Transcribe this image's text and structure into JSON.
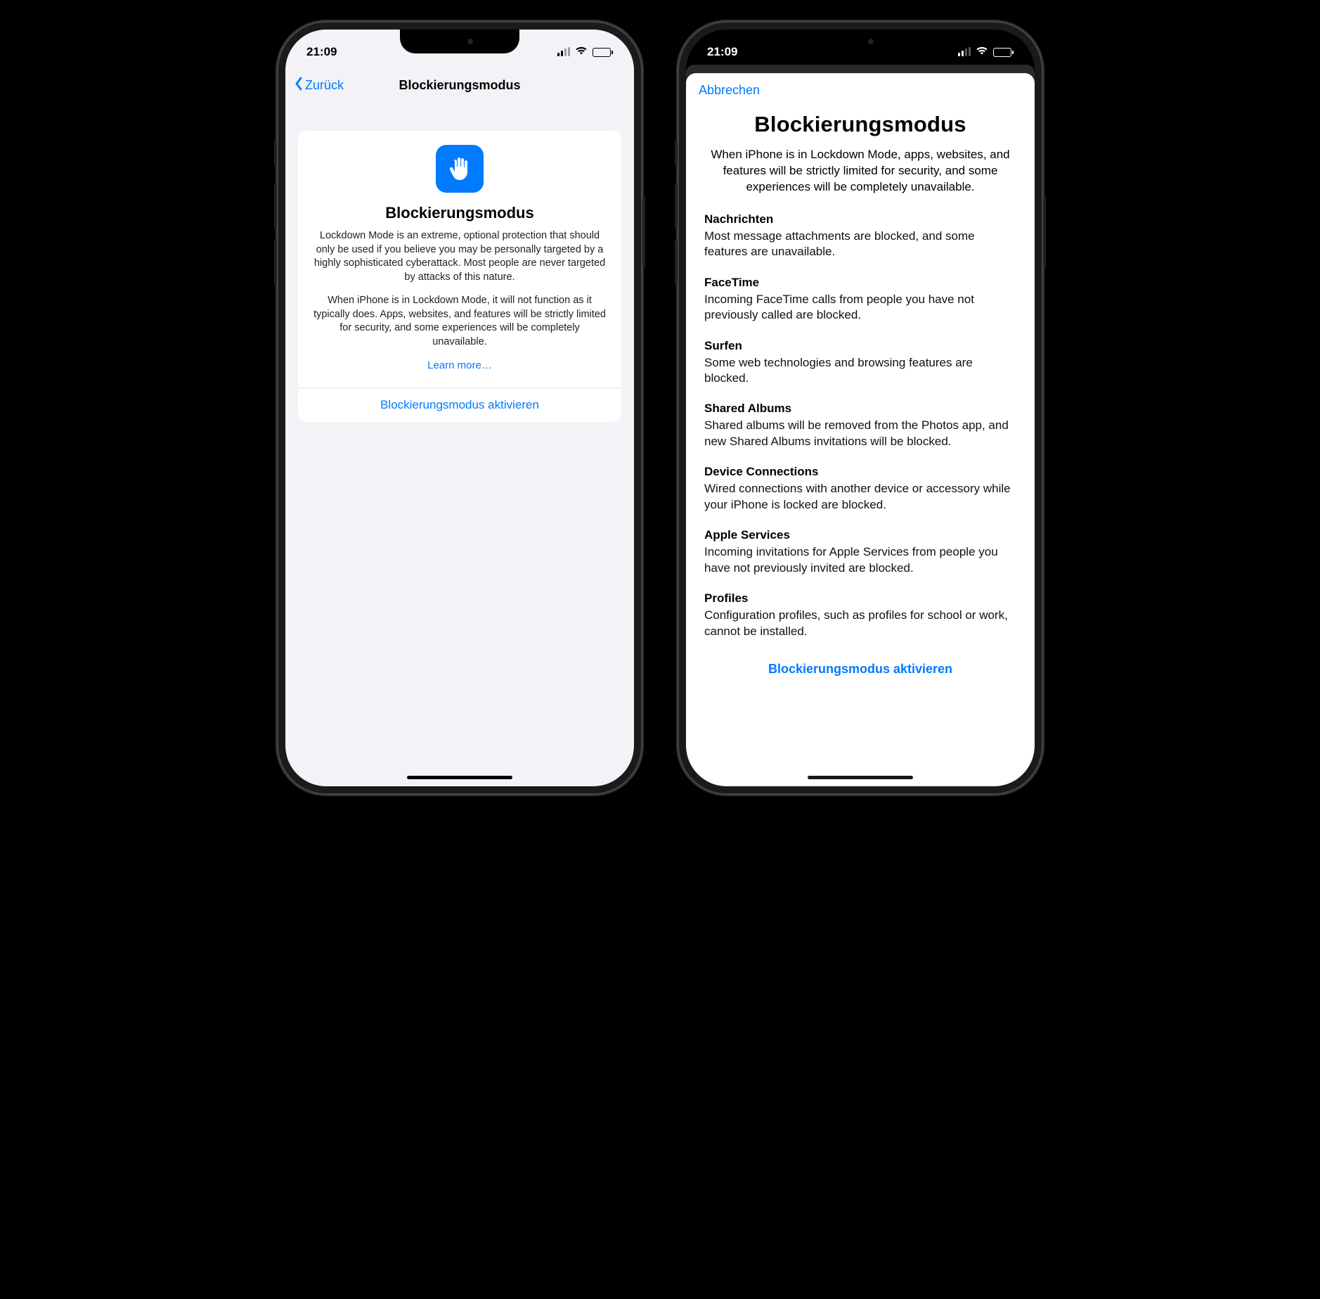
{
  "status": {
    "time": "21:09"
  },
  "left": {
    "back_label": "Zurück",
    "nav_title": "Blockierungsmodus",
    "icon_name": "hand-raised-icon",
    "card_title": "Blockierungsmodus",
    "paragraph1": "Lockdown Mode is an extreme, optional protection that should only be used if you believe you may be personally targeted by a highly sophisticated cyberattack. Most people are never targeted by attacks of this nature.",
    "paragraph2": "When iPhone is in Lockdown Mode, it will not function as it typically does. Apps, websites, and features will be strictly limited for security, and some experiences will be completely unavailable.",
    "learn_more": "Learn more…",
    "activate": "Blockierungsmodus aktivieren"
  },
  "right": {
    "cancel": "Abbrechen",
    "title": "Blockierungsmodus",
    "lead": "When iPhone is in Lockdown Mode, apps, websites, and features will be strictly limited for security, and some experiences will be completely unavailable.",
    "sections": [
      {
        "head": "Nachrichten",
        "body": "Most message attachments are blocked, and some features are unavailable."
      },
      {
        "head": "FaceTime",
        "body": "Incoming FaceTime calls from people you have not previously called are blocked."
      },
      {
        "head": "Surfen",
        "body": "Some web technologies and browsing features are blocked."
      },
      {
        "head": "Shared Albums",
        "body": "Shared albums will be removed from the Photos app, and new Shared Albums invitations will be blocked."
      },
      {
        "head": "Device Connections",
        "body": "Wired connections with another device or accessory while your iPhone is locked are blocked."
      },
      {
        "head": "Apple Services",
        "body": "Incoming invitations for Apple Services from people you have not previously invited are blocked."
      },
      {
        "head": "Profiles",
        "body": "Configuration profiles, such as profiles for school or work, cannot be installed."
      }
    ],
    "activate": "Blockierungsmodus aktivieren"
  }
}
